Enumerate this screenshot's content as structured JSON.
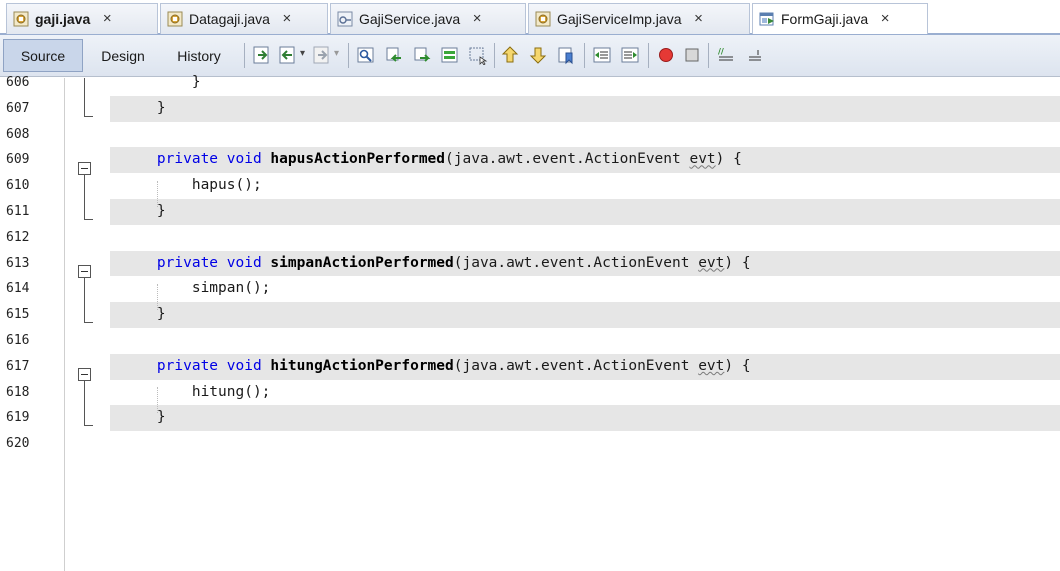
{
  "tabs": [
    {
      "label": "gaji.java",
      "bold": true,
      "active": false,
      "icon": "java-form-icon"
    },
    {
      "label": "Datagaji.java",
      "bold": false,
      "active": false,
      "icon": "java-form-icon"
    },
    {
      "label": "GajiService.java",
      "bold": false,
      "active": false,
      "icon": "java-interface-icon"
    },
    {
      "label": "GajiServiceImp.java",
      "bold": false,
      "active": false,
      "icon": "java-form-icon"
    },
    {
      "label": "FormGaji.java",
      "bold": false,
      "active": true,
      "icon": "java-frame-icon"
    }
  ],
  "tab_close_glyph": "×",
  "toolbar": {
    "source_label": "Source",
    "design_label": "Design",
    "history_label": "History",
    "icons": [
      "last-edit-icon",
      "back-icon",
      "forward-icon",
      "find-icon",
      "find-prev-icon",
      "find-next-icon",
      "toggle-highlight-icon",
      "toggle-rect-select-icon",
      "prev-bookmark-icon",
      "next-bookmark-icon",
      "toggle-bookmark-icon",
      "shift-left-icon",
      "shift-right-icon",
      "start-macro-icon",
      "stop-macro-icon",
      "comment-icon",
      "uncomment-icon"
    ]
  },
  "editor": {
    "lines": [
      {
        "num": "606",
        "code": "        }",
        "shade": false
      },
      {
        "num": "607",
        "code": "    }",
        "shade": true
      },
      {
        "num": "608",
        "code": "",
        "shade": false
      },
      {
        "num": "609",
        "pre": "    ",
        "kw": "private void ",
        "name": "hapusActionPerformed",
        "rest": "(java.awt.event.ActionEvent ",
        "squig": "evt",
        "tail": ") {",
        "shade": true
      },
      {
        "num": "610",
        "code": "        hapus();",
        "shade": false
      },
      {
        "num": "611",
        "code": "    }",
        "shade": true
      },
      {
        "num": "612",
        "code": "",
        "shade": false
      },
      {
        "num": "613",
        "pre": "    ",
        "kw": "private void ",
        "name": "simpanActionPerformed",
        "rest": "(java.awt.event.ActionEvent ",
        "squig": "evt",
        "tail": ") {",
        "shade": true
      },
      {
        "num": "614",
        "code": "        simpan();",
        "shade": false
      },
      {
        "num": "615",
        "code": "    }",
        "shade": true
      },
      {
        "num": "616",
        "code": "",
        "shade": false
      },
      {
        "num": "617",
        "pre": "    ",
        "kw": "private void ",
        "name": "hitungActionPerformed",
        "rest": "(java.awt.event.ActionEvent ",
        "squig": "evt",
        "tail": ") {",
        "shade": true
      },
      {
        "num": "618",
        "code": "        hitung();",
        "shade": false
      },
      {
        "num": "619",
        "code": "    }",
        "shade": true
      },
      {
        "num": "620",
        "code": "",
        "shade": false
      }
    ]
  }
}
